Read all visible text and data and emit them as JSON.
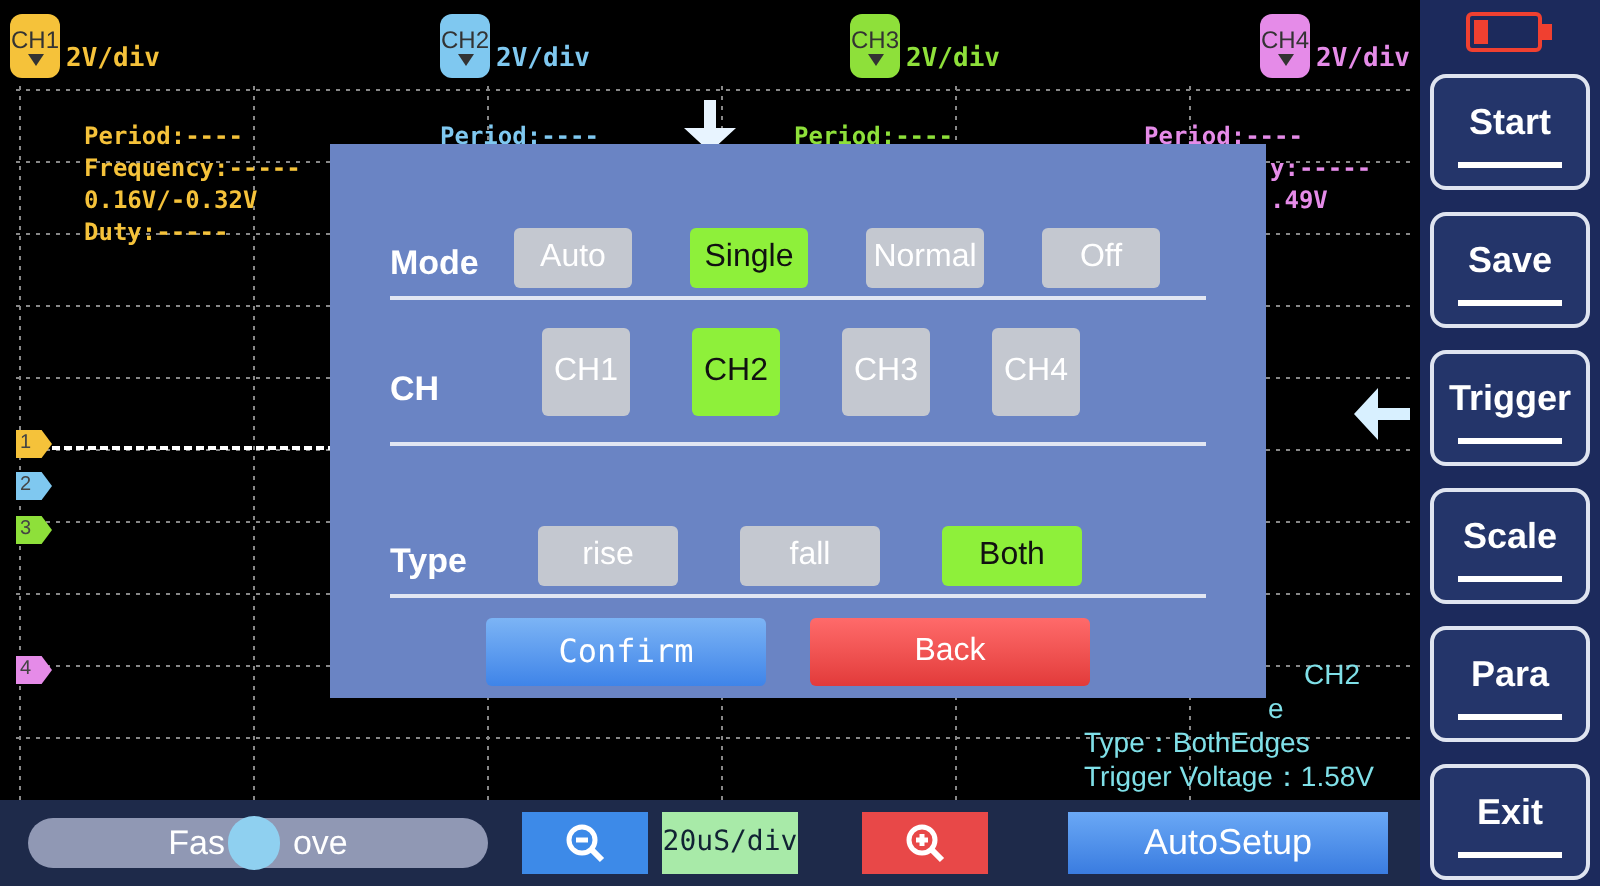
{
  "channels": [
    {
      "label": "CH1",
      "scale": "2V/div",
      "color": "#f5c23a"
    },
    {
      "label": "CH2",
      "scale": "2V/div",
      "color": "#7fc8f0"
    },
    {
      "label": "CH3",
      "scale": "2V/div",
      "color": "#8ee03a"
    },
    {
      "label": "CH4",
      "scale": "2V/div",
      "color": "#e58be8"
    }
  ],
  "measurements": [
    {
      "lines": [
        "Period:----",
        "Frequency:-----",
        "0.16V/-0.32V",
        "Duty:-----"
      ]
    },
    {
      "lines": [
        "Period:----"
      ]
    },
    {
      "lines": [
        "Period:----"
      ]
    },
    {
      "lines": [
        "Period:----",
        "y:-----",
        ".49V"
      ]
    }
  ],
  "markers": [
    {
      "label": "1"
    },
    {
      "label": "2"
    },
    {
      "label": "3"
    },
    {
      "label": "4"
    }
  ],
  "trigger_info": [
    "CH2",
    "e",
    "Type：BothEdges",
    "Trigger Voltage：1.58V"
  ],
  "dialog": {
    "rows": [
      {
        "label": "Mode",
        "options": [
          {
            "label": "Auto",
            "selected": false
          },
          {
            "label": "Single",
            "selected": true
          },
          {
            "label": "Normal",
            "selected": false
          },
          {
            "label": "Off",
            "selected": false
          }
        ]
      },
      {
        "label": "CH",
        "options": [
          {
            "label": "CH1",
            "selected": false
          },
          {
            "label": "CH2",
            "selected": true
          },
          {
            "label": "CH3",
            "selected": false
          },
          {
            "label": "CH4",
            "selected": false
          }
        ]
      },
      {
        "label": "Type",
        "options": [
          {
            "label": "rise",
            "selected": false
          },
          {
            "label": "fall",
            "selected": false
          },
          {
            "label": "Both",
            "selected": true
          }
        ]
      }
    ],
    "buttons": [
      {
        "label": "Confirm",
        "kind": "confirm"
      },
      {
        "label": "Back",
        "kind": "cancel"
      }
    ]
  },
  "bottom_bar": {
    "slider": {
      "label_left": "Fas",
      "label_right": "ove",
      "level": 0.49
    },
    "timebase": "20uS/div",
    "autosetup": "AutoSetup"
  },
  "sidebar": [
    "Start",
    "Save",
    "Trigger",
    "Scale",
    "Para",
    "Exit"
  ]
}
